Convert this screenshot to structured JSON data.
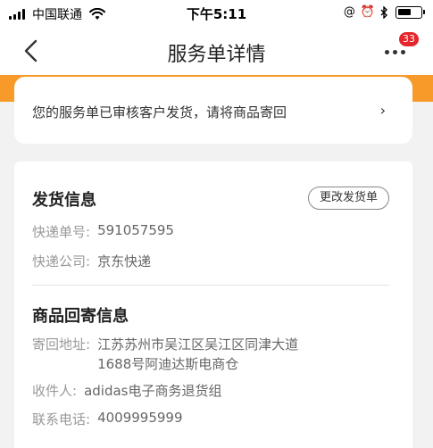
{
  "status_bar": {
    "carrier": "中国联通",
    "time": "下午5:11",
    "battery_level": 0.6
  },
  "nav": {
    "title": "服务单详情",
    "badge_count": "33"
  },
  "status_card": {
    "text": "您的服务单已审核客户发货，请将商品寄回",
    "arrow": "›"
  },
  "shipping": {
    "title": "发货信息",
    "modify_button": "更改发货单",
    "tracking_label": "快递单号:",
    "tracking_value": "591057595",
    "courier_label": "快递公司:",
    "courier_value": "京东快递"
  },
  "return_info": {
    "title": "商品回寄信息",
    "address_label": "寄回地址:",
    "address_value": "江苏苏州市吴江区吴江区同津大道1688号阿迪达斯电商仓",
    "recipient_label": "收件人:",
    "recipient_value": "adidas电子商务退货组",
    "phone_label": "联系电话:",
    "phone_value": "4009995999"
  },
  "colors": {
    "accent_orange": "#f79a2a",
    "badge_red": "#e5262b"
  }
}
